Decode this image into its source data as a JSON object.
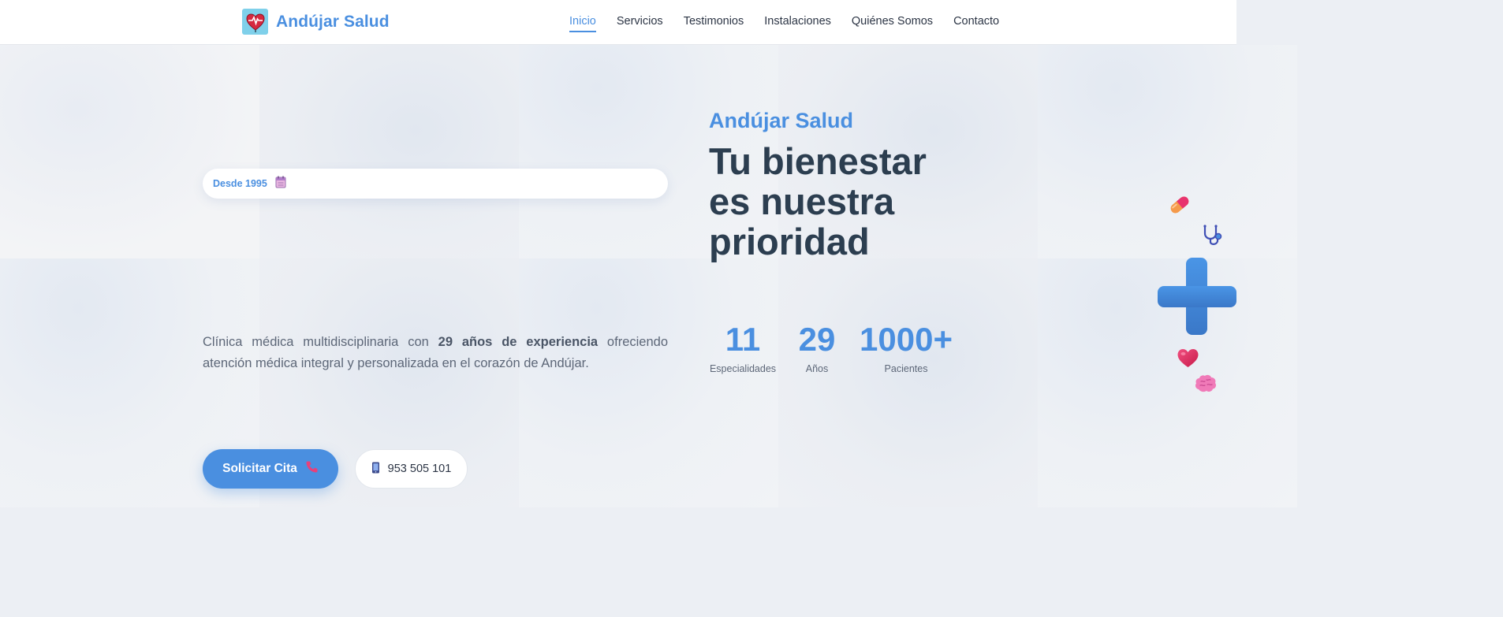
{
  "header": {
    "brand_name": "Andújar Salud",
    "logo_icon": "heart-pulse-icon",
    "nav": [
      {
        "label": "Inicio",
        "active": true
      },
      {
        "label": "Servicios"
      },
      {
        "label": "Testimonios"
      },
      {
        "label": "Instalaciones"
      },
      {
        "label": "Quiénes Somos"
      },
      {
        "label": "Contacto"
      }
    ]
  },
  "hero": {
    "badge_text": "Desde 1995",
    "badge_icon": "calendar-icon",
    "kicker": "Andújar Salud",
    "title": "Tu bienestar es nuestra prioridad",
    "description_before": "Clínica médica multidisciplinaria con ",
    "description_strong": "29 años de experiencia",
    "description_after": " ofreciendo atención médica integral y personalizada en el corazón de Andújar.",
    "cta_label": "Solicitar Cita",
    "cta_icon": "phone-icon",
    "phone_label": "953 505 101",
    "phone_icon": "mobile-phone-icon"
  },
  "stats": [
    {
      "value": "11",
      "label": "Especialidades"
    },
    {
      "value": "29",
      "label": "Años"
    },
    {
      "value": "1000+",
      "label": "Pacientes"
    }
  ],
  "colors": {
    "accent": "#4a8fe0",
    "heading": "#2c3e50",
    "text": "#5d6778",
    "background": "#eceff4"
  },
  "floating_icons": [
    "pill-icon",
    "stethoscope-icon",
    "medical-cross-icon",
    "heart-icon",
    "brain-icon"
  ]
}
